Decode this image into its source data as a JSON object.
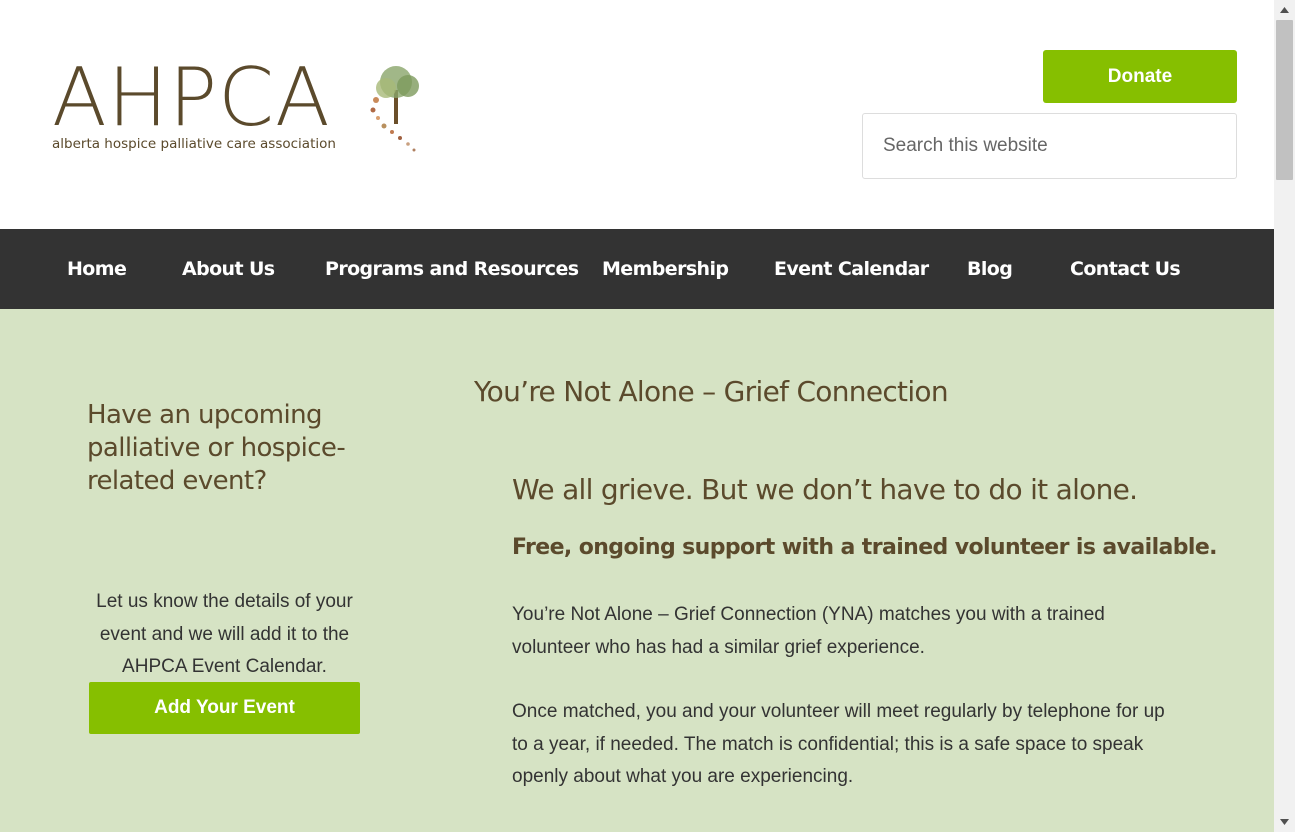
{
  "header": {
    "logo_text": "AHPCA",
    "logo_subtitle": "alberta hospice palliative care association",
    "donate_label": "Donate",
    "search_placeholder": "Search this website"
  },
  "nav": {
    "items": [
      {
        "label": "Home"
      },
      {
        "label": "About Us"
      },
      {
        "label": "Programs and Resources"
      },
      {
        "label": "Membership"
      },
      {
        "label": "Event Calendar"
      },
      {
        "label": "Blog"
      },
      {
        "label": "Contact Us"
      }
    ]
  },
  "sidebar": {
    "heading": "Have an upcoming palliative or hospice-related event?",
    "text": "Let us know the details of your event and we will add it to the AHPCA Event Calendar.",
    "button_label": "Add Your Event"
  },
  "main": {
    "title": "You’re Not Alone – Grief Connection",
    "heading": "We all grieve. But we don’t have to do it alone.",
    "subheading": "Free, ongoing support with a trained volunteer is available.",
    "paragraphs": [
      "You’re Not Alone – Grief Connection (YNA) matches you with a trained volunteer who has had a similar grief experience.",
      "Once matched, you and your volunteer will meet regularly by telephone for up to a year, if needed. The match is confidential; this is a safe space to speak openly about what you are experiencing."
    ]
  },
  "colors": {
    "brand_green": "#86bf00",
    "brand_brown": "#5b4a2c",
    "nav_bg": "#333333",
    "content_bg": "#d6e3c4"
  },
  "icons": {
    "logo_tree": "tree-with-falling-leaves-icon",
    "logo_leaf": "leaf-icon"
  }
}
